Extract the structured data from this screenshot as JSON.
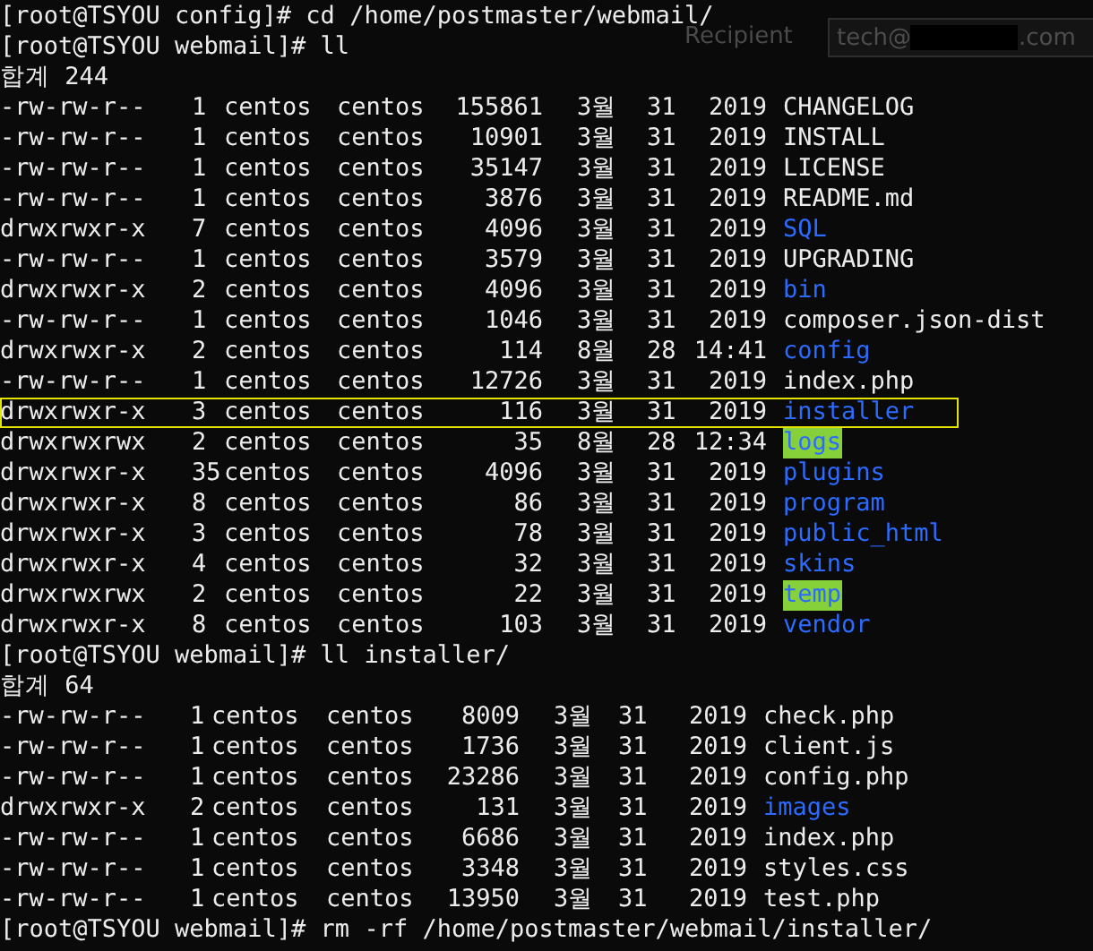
{
  "background_window": {
    "label": "Recipient",
    "field_value_start": "tech@",
    "field_value_end": ".com"
  },
  "terminal": {
    "blocks": [
      {
        "kind": "prompt",
        "text": "[root@TSYOU config]# cd /home/postmaster/webmail/"
      },
      {
        "kind": "prompt",
        "text": "[root@TSYOU webmail]# ll"
      },
      {
        "kind": "listing",
        "total": "합계 244",
        "entries": [
          {
            "perms": "-rw-rw-r--",
            "links": "1",
            "owner": "centos",
            "group": "centos",
            "size": "155861",
            "month": "3월",
            "day": "31",
            "time": "2019",
            "name": "CHANGELOG",
            "kind": "file",
            "selected": false
          },
          {
            "perms": "-rw-rw-r--",
            "links": "1",
            "owner": "centos",
            "group": "centos",
            "size": "10901",
            "month": "3월",
            "day": "31",
            "time": "2019",
            "name": "INSTALL",
            "kind": "file",
            "selected": false
          },
          {
            "perms": "-rw-rw-r--",
            "links": "1",
            "owner": "centos",
            "group": "centos",
            "size": "35147",
            "month": "3월",
            "day": "31",
            "time": "2019",
            "name": "LICENSE",
            "kind": "file",
            "selected": false
          },
          {
            "perms": "-rw-rw-r--",
            "links": "1",
            "owner": "centos",
            "group": "centos",
            "size": "3876",
            "month": "3월",
            "day": "31",
            "time": "2019",
            "name": "README.md",
            "kind": "file",
            "selected": false
          },
          {
            "perms": "drwxrwxr-x",
            "links": "7",
            "owner": "centos",
            "group": "centos",
            "size": "4096",
            "month": "3월",
            "day": "31",
            "time": "2019",
            "name": "SQL",
            "kind": "dir",
            "selected": false
          },
          {
            "perms": "-rw-rw-r--",
            "links": "1",
            "owner": "centos",
            "group": "centos",
            "size": "3579",
            "month": "3월",
            "day": "31",
            "time": "2019",
            "name": "UPGRADING",
            "kind": "file",
            "selected": false
          },
          {
            "perms": "drwxrwxr-x",
            "links": "2",
            "owner": "centos",
            "group": "centos",
            "size": "4096",
            "month": "3월",
            "day": "31",
            "time": "2019",
            "name": "bin",
            "kind": "dir",
            "selected": false
          },
          {
            "perms": "-rw-rw-r--",
            "links": "1",
            "owner": "centos",
            "group": "centos",
            "size": "1046",
            "month": "3월",
            "day": "31",
            "time": "2019",
            "name": "composer.json-dist",
            "kind": "file",
            "selected": false
          },
          {
            "perms": "drwxrwxr-x",
            "links": "2",
            "owner": "centos",
            "group": "centos",
            "size": "114",
            "month": "8월",
            "day": "28",
            "time": "14:41",
            "name": "config",
            "kind": "dir",
            "selected": false
          },
          {
            "perms": "-rw-rw-r--",
            "links": "1",
            "owner": "centos",
            "group": "centos",
            "size": "12726",
            "month": "3월",
            "day": "31",
            "time": "2019",
            "name": "index.php",
            "kind": "file",
            "selected": false
          },
          {
            "perms": "drwxrwxr-x",
            "links": "3",
            "owner": "centos",
            "group": "centos",
            "size": "116",
            "month": "3월",
            "day": "31",
            "time": "2019",
            "name": "installer",
            "kind": "dir",
            "selected": true
          },
          {
            "perms": "drwxrwxrwx",
            "links": "2",
            "owner": "centos",
            "group": "centos",
            "size": "35",
            "month": "8월",
            "day": "28",
            "time": "12:34",
            "name": "logs",
            "kind": "writable",
            "selected": false
          },
          {
            "perms": "drwxrwxr-x",
            "links": "35",
            "owner": "centos",
            "group": "centos",
            "size": "4096",
            "month": "3월",
            "day": "31",
            "time": "2019",
            "name": "plugins",
            "kind": "dir",
            "selected": false
          },
          {
            "perms": "drwxrwxr-x",
            "links": "8",
            "owner": "centos",
            "group": "centos",
            "size": "86",
            "month": "3월",
            "day": "31",
            "time": "2019",
            "name": "program",
            "kind": "dir",
            "selected": false
          },
          {
            "perms": "drwxrwxr-x",
            "links": "3",
            "owner": "centos",
            "group": "centos",
            "size": "78",
            "month": "3월",
            "day": "31",
            "time": "2019",
            "name": "public_html",
            "kind": "dir",
            "selected": false
          },
          {
            "perms": "drwxrwxr-x",
            "links": "4",
            "owner": "centos",
            "group": "centos",
            "size": "32",
            "month": "3월",
            "day": "31",
            "time": "2019",
            "name": "skins",
            "kind": "dir",
            "selected": false
          },
          {
            "perms": "drwxrwxrwx",
            "links": "2",
            "owner": "centos",
            "group": "centos",
            "size": "22",
            "month": "3월",
            "day": "31",
            "time": "2019",
            "name": "temp",
            "kind": "writable",
            "selected": false
          },
          {
            "perms": "drwxrwxr-x",
            "links": "8",
            "owner": "centos",
            "group": "centos",
            "size": "103",
            "month": "3월",
            "day": "31",
            "time": "2019",
            "name": "vendor",
            "kind": "dir",
            "selected": false
          }
        ]
      },
      {
        "kind": "prompt",
        "text": "[root@TSYOU webmail]# ll installer/"
      },
      {
        "kind": "listing",
        "total": "합계 64",
        "entries": [
          {
            "perms": "-rw-rw-r--",
            "links": "1",
            "owner": "centos",
            "group": "centos",
            "size": "8009",
            "month": "3월",
            "day": "31",
            "time": "2019",
            "name": "check.php",
            "kind": "file",
            "selected": false
          },
          {
            "perms": "-rw-rw-r--",
            "links": "1",
            "owner": "centos",
            "group": "centos",
            "size": "1736",
            "month": "3월",
            "day": "31",
            "time": "2019",
            "name": "client.js",
            "kind": "file",
            "selected": false
          },
          {
            "perms": "-rw-rw-r--",
            "links": "1",
            "owner": "centos",
            "group": "centos",
            "size": "23286",
            "month": "3월",
            "day": "31",
            "time": "2019",
            "name": "config.php",
            "kind": "file",
            "selected": false
          },
          {
            "perms": "drwxrwxr-x",
            "links": "2",
            "owner": "centos",
            "group": "centos",
            "size": "131",
            "month": "3월",
            "day": "31",
            "time": "2019",
            "name": "images",
            "kind": "dir",
            "selected": false
          },
          {
            "perms": "-rw-rw-r--",
            "links": "1",
            "owner": "centos",
            "group": "centos",
            "size": "6686",
            "month": "3월",
            "day": "31",
            "time": "2019",
            "name": "index.php",
            "kind": "file",
            "selected": false
          },
          {
            "perms": "-rw-rw-r--",
            "links": "1",
            "owner": "centos",
            "group": "centos",
            "size": "3348",
            "month": "3월",
            "day": "31",
            "time": "2019",
            "name": "styles.css",
            "kind": "file",
            "selected": false
          },
          {
            "perms": "-rw-rw-r--",
            "links": "1",
            "owner": "centos",
            "group": "centos",
            "size": "13950",
            "month": "3월",
            "day": "31",
            "time": "2019",
            "name": "test.php",
            "kind": "file",
            "selected": false
          }
        ]
      },
      {
        "kind": "prompt",
        "text": "[root@TSYOU webmail]# rm -rf /home/postmaster/webmail/installer/"
      }
    ]
  }
}
